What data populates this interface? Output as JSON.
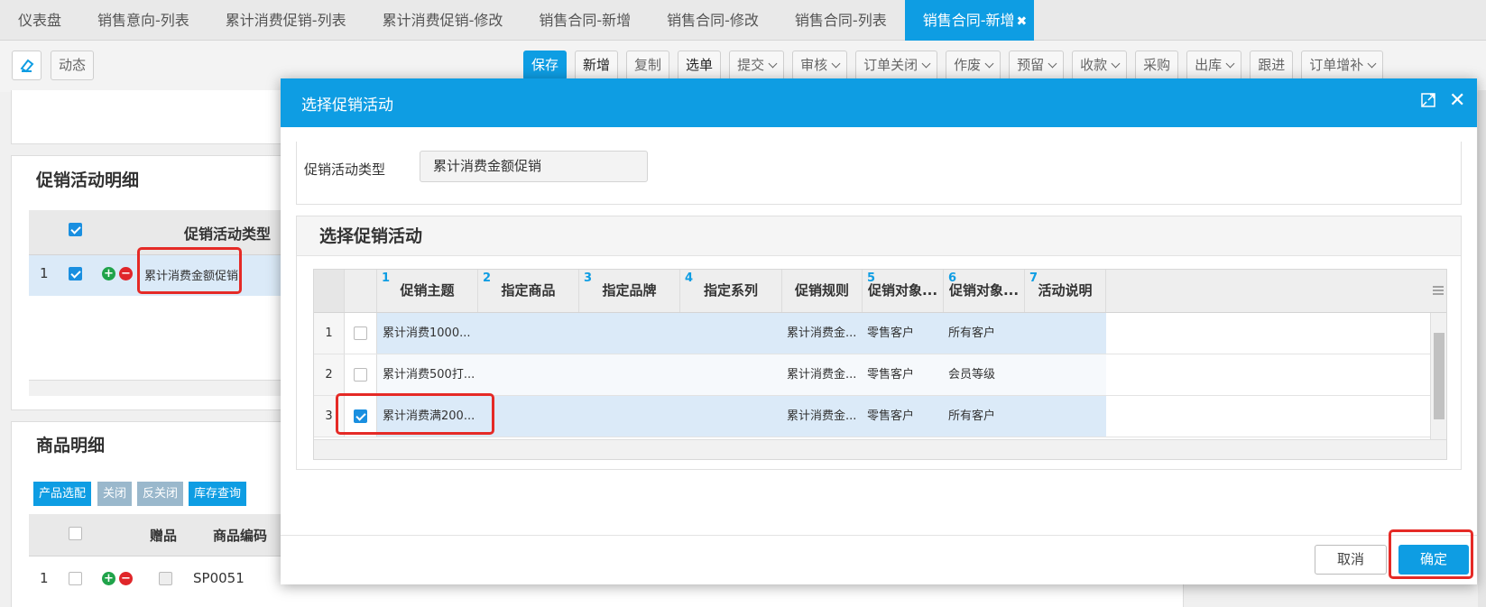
{
  "tabs": [
    {
      "label": "仪表盘"
    },
    {
      "label": "销售意向-列表"
    },
    {
      "label": "累计消费促销-列表"
    },
    {
      "label": "累计消费促销-修改"
    },
    {
      "label": "销售合同-新增"
    },
    {
      "label": "销售合同-修改"
    },
    {
      "label": "销售合同-列表"
    },
    {
      "label": "销售合同-新增",
      "active": true
    }
  ],
  "toolbar": {
    "dynamic": "动态",
    "buttons": [
      "保存",
      "新增",
      "复制",
      "选单",
      "提交",
      "审核",
      "订单关闭",
      "作废",
      "预留",
      "收款",
      "采购",
      "出库",
      "跟进",
      "订单增补"
    ]
  },
  "background": {
    "promo_section_title": "促销活动明细",
    "promo_col_type": "促销活动类型",
    "promo_row_index": "1",
    "promo_row_type": "累计消费金额促销",
    "goods_section_title": "商品明细",
    "goods_buttons": [
      "产品选配",
      "关闭",
      "反关闭",
      "库存查询"
    ],
    "goods_col_gift": "赠品",
    "goods_col_code": "商品编码",
    "goods_row_index": "1",
    "goods_row_code": "SP0051"
  },
  "modal": {
    "title": "选择促销活动",
    "filter_label": "促销活动类型",
    "filter_value": "累计消费金额促销",
    "section_title": "选择促销活动",
    "columns": [
      {
        "num": "1",
        "label": "促销主题"
      },
      {
        "num": "2",
        "label": "指定商品"
      },
      {
        "num": "3",
        "label": "指定品牌"
      },
      {
        "num": "4",
        "label": "指定系列"
      },
      {
        "num": "",
        "label": "促销规则"
      },
      {
        "num": "5",
        "label": "促销对象..."
      },
      {
        "num": "6",
        "label": "促销对象..."
      },
      {
        "num": "7",
        "label": "活动说明"
      }
    ],
    "rows": [
      {
        "index": "1",
        "checked": false,
        "theme": "累计消费1000...",
        "rule": "累计消费金...",
        "target1": "零售客户",
        "target2": "所有客户"
      },
      {
        "index": "2",
        "checked": false,
        "theme": "累计消费500打...",
        "rule": "累计消费金...",
        "target1": "零售客户",
        "target2": "会员等级"
      },
      {
        "index": "3",
        "checked": true,
        "theme": "累计消费满200...",
        "rule": "累计消费金...",
        "target1": "零售客户",
        "target2": "所有客户"
      }
    ],
    "cancel_label": "取消",
    "ok_label": "确定"
  },
  "colors": {
    "accent": "#0e9de3",
    "highlight_border": "#e52a26"
  }
}
